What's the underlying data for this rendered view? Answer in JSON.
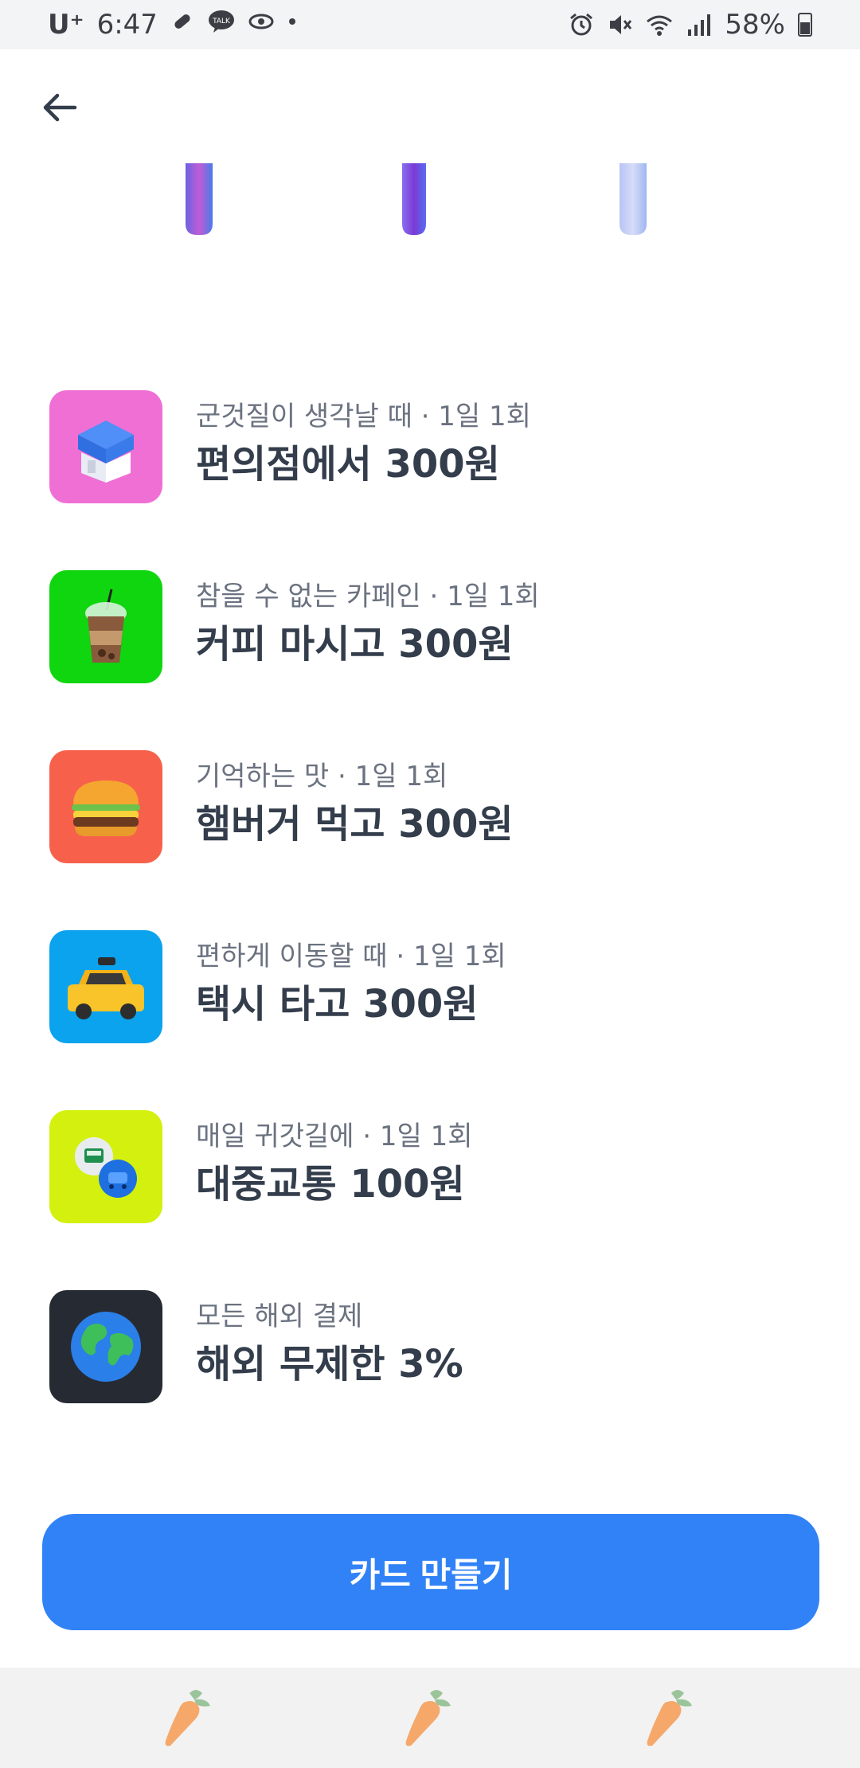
{
  "status_bar": {
    "carrier": "U⁺",
    "time": "6:47",
    "battery_percent": "58%",
    "left_icons": [
      "pill-icon",
      "talk-icon",
      "eye-icon",
      "dot-icon"
    ],
    "right_icons": [
      "alarm-icon",
      "mute-icon",
      "wifi-icon",
      "signal-icon",
      "battery-icon"
    ]
  },
  "benefits": [
    {
      "subtitle": "군것질이 생각날 때 · 1일 1회",
      "title": "편의점에서 300원",
      "icon": "convenience-store-icon",
      "color": "#ef6fd4"
    },
    {
      "subtitle": "참을 수 없는 카페인 · 1일 1회",
      "title": "커피 마시고 300원",
      "icon": "coffee-cup-icon",
      "color": "#0fd60f"
    },
    {
      "subtitle": "기억하는 맛 · 1일 1회",
      "title": "햄버거 먹고 300원",
      "icon": "hamburger-icon",
      "color": "#f7614b"
    },
    {
      "subtitle": "편하게 이동할 때 · 1일 1회",
      "title": "택시 타고 300원",
      "icon": "taxi-icon",
      "color": "#0ba2ee"
    },
    {
      "subtitle": "매일 귀갓길에 · 1일 1회",
      "title": "대중교통 100원",
      "icon": "transit-icon",
      "color": "#d4f00f"
    },
    {
      "subtitle": "모든 해외 결제",
      "title": "해외 무제한 3%",
      "icon": "globe-icon",
      "color": "#262a33"
    }
  ],
  "cta": {
    "label": "카드 만들기"
  },
  "colors": {
    "accent": "#3182f6",
    "title_text": "#333d4b",
    "subtitle_text": "#6b7280"
  }
}
